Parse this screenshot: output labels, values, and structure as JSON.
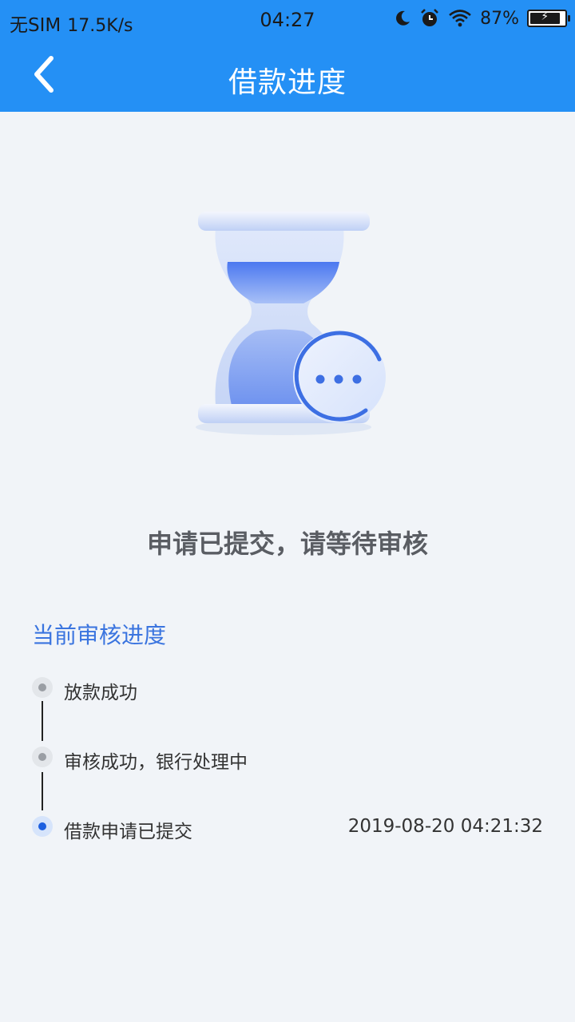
{
  "status_bar": {
    "carrier": "无SIM",
    "speed": "17.5K/s",
    "time": "04:27",
    "battery_pct": "87%",
    "battery_level": 0.87,
    "icons": [
      "moon-icon",
      "alarm-icon",
      "wifi-icon",
      "battery-charging-icon"
    ]
  },
  "nav": {
    "title": "借款进度",
    "back_icon": "chevron-left-icon"
  },
  "hero": {
    "icon": "hourglass-pending-icon",
    "message": "申请已提交，请等待审核"
  },
  "progress": {
    "title": "当前审核进度",
    "steps": [
      {
        "label": "放款成功",
        "time": "",
        "active": false
      },
      {
        "label": "审核成功，银行处理中",
        "time": "",
        "active": false
      },
      {
        "label": "借款申请已提交",
        "time": "2019-08-20 04:21:32",
        "active": true
      }
    ]
  },
  "colors": {
    "header": "#2490f5",
    "background": "#f1f4f8",
    "accent": "#3a74df",
    "active_dot": "#1c5fe0"
  }
}
